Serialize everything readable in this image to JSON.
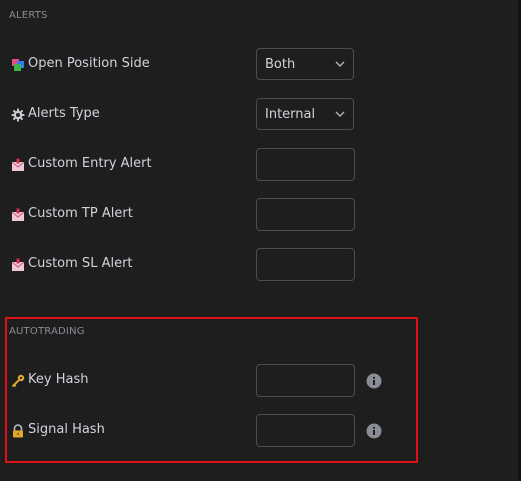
{
  "alerts_section": {
    "title": "ALERTS",
    "rows": [
      {
        "label": "Open Position Side",
        "icon": "colored-squares-icon",
        "control": "select",
        "value": "Both"
      },
      {
        "label": "Alerts Type",
        "icon": "gear-icon",
        "control": "select",
        "value": "Internal"
      },
      {
        "label": "Custom Entry Alert",
        "icon": "envelope-icon",
        "control": "text",
        "value": ""
      },
      {
        "label": "Custom TP Alert",
        "icon": "envelope-icon",
        "control": "text",
        "value": ""
      },
      {
        "label": "Custom SL Alert",
        "icon": "envelope-icon",
        "control": "text",
        "value": ""
      }
    ]
  },
  "autotrading_section": {
    "title": "AUTOTRADING",
    "highlight_color": "#e3101a",
    "rows": [
      {
        "label": "Key Hash",
        "icon": "key-icon",
        "control": "text",
        "value": "",
        "info": "info-icon"
      },
      {
        "label": "Signal Hash",
        "icon": "lock-icon",
        "control": "text",
        "value": "",
        "info": "info-icon"
      }
    ]
  },
  "colors": {
    "background": "#1e1e1e",
    "text": "#d1d4dc",
    "section_title": "#8a8d95",
    "input_border": "#4a4d55"
  }
}
